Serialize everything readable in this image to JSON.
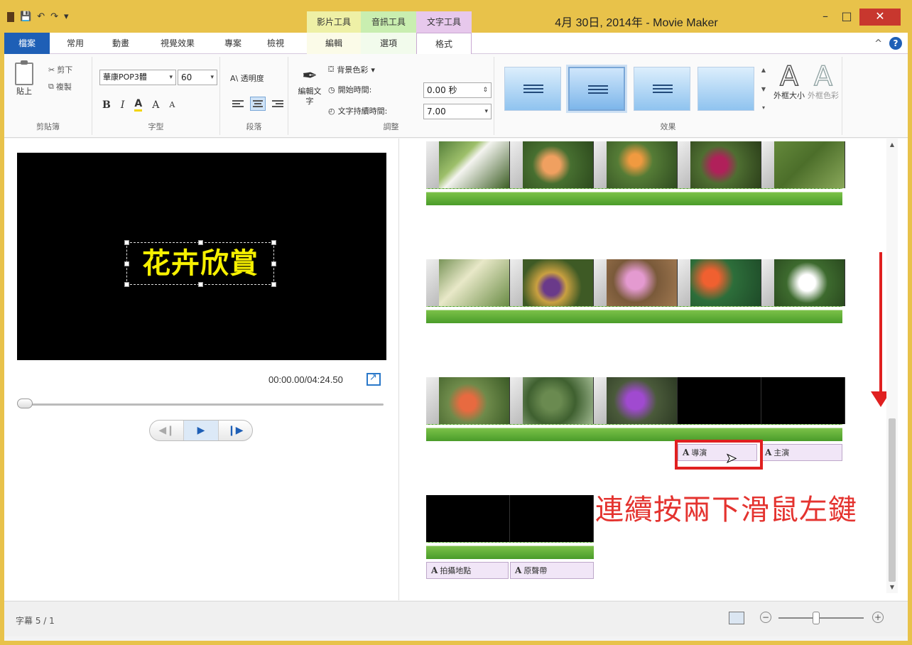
{
  "window": {
    "title": "4月 30日, 2014年 - Movie Maker",
    "minimize": "–",
    "maximize": "□",
    "close": "✕"
  },
  "qat": {
    "save": "💾",
    "undo": "↶",
    "redo": "↷",
    "more": "▾"
  },
  "context_groups": {
    "video": "影片工具",
    "audio": "音訊工具",
    "text": "文字工具"
  },
  "tabs": {
    "file": "檔案",
    "home": "常用",
    "animation": "動畫",
    "visual_effects": "視覺效果",
    "project": "專案",
    "view": "檢視",
    "edit": "編輯",
    "options": "選項",
    "format": "格式"
  },
  "help": {
    "collapse": "^",
    "icon": "?"
  },
  "ribbon": {
    "clipboard": {
      "label": "剪貼簿",
      "paste": "貼上",
      "cut": "剪下",
      "copy": "複製"
    },
    "font": {
      "label": "字型",
      "family": "華康POP3體",
      "size": "60",
      "bold": "B",
      "italic": "I",
      "color": "A",
      "grow": "A",
      "shrink": "A"
    },
    "paragraph": {
      "label": "段落",
      "transparency": "透明度"
    },
    "adjust": {
      "label": "調整",
      "edit_text": "編輯文字",
      "bg_color": "背景色彩",
      "start_time_label": "開始時間:",
      "start_time_value": "0.00 秒",
      "duration_label": "文字持續時間:",
      "duration_value": "7.00"
    },
    "effects": {
      "label": "效果",
      "outline_size": "外框大小",
      "outline_color": "外框色彩"
    }
  },
  "preview": {
    "title_text": "花卉欣賞",
    "time": "00:00.00/04:24.50",
    "prev": "◀❙",
    "play": "▶",
    "next": "❙▶"
  },
  "storyboard": {
    "captions": [
      "導演",
      "主演",
      "拍攝地點",
      "原聲帶"
    ],
    "instruction": "連續按兩下滑鼠左鍵"
  },
  "status": {
    "text": "字幕 5 / 1",
    "zoom_out": "−",
    "zoom_in": "+"
  },
  "colors": {
    "accent": "#1e5fb6",
    "frame": "#e8c24a",
    "title_yellow": "#f6f000",
    "annotation_red": "#e02020"
  }
}
